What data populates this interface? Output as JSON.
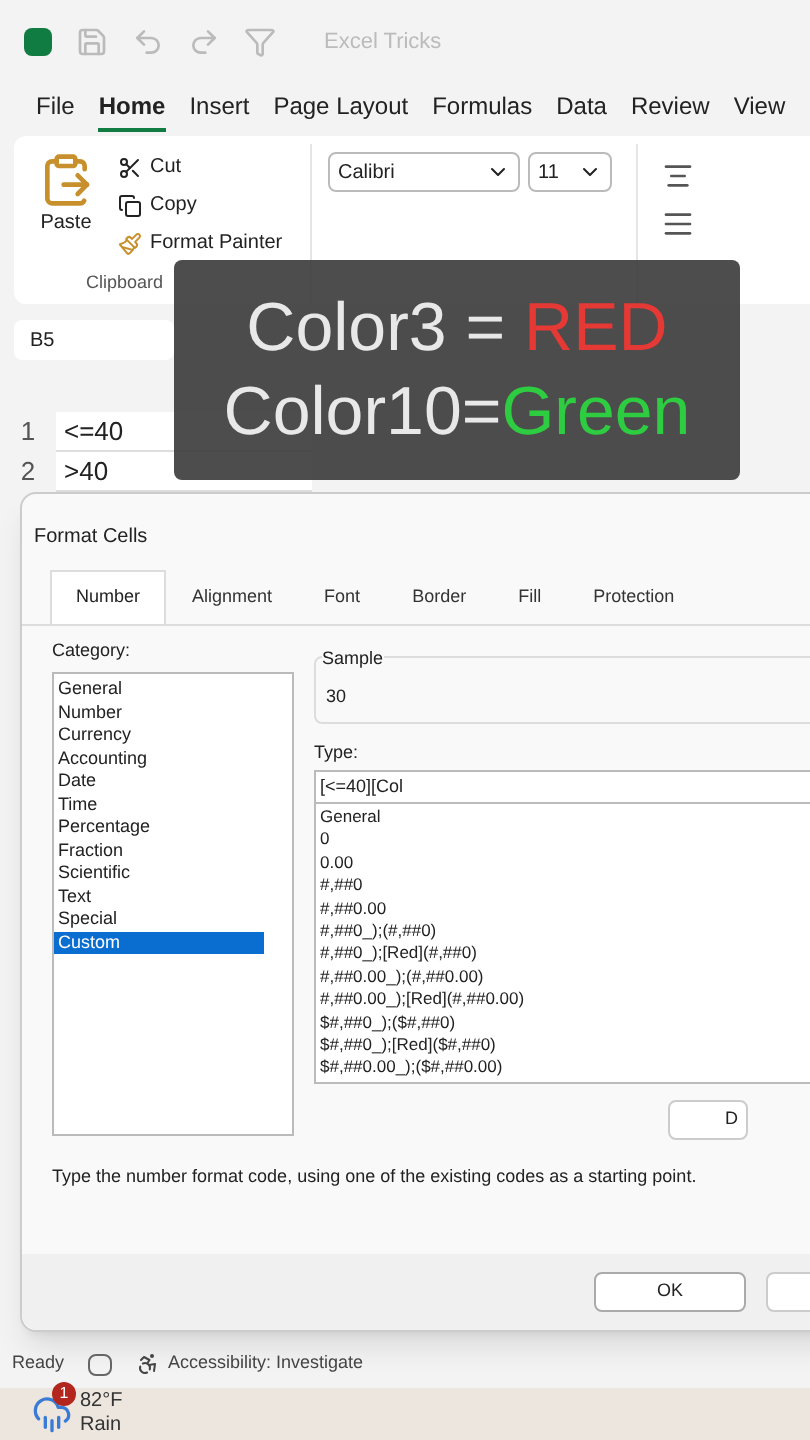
{
  "title_bar": {
    "document": "Excel Tricks"
  },
  "ribbon_tabs": [
    {
      "label": "File",
      "selected": false
    },
    {
      "label": "Home",
      "selected": true
    },
    {
      "label": "Insert",
      "selected": false
    },
    {
      "label": "Page Layout",
      "selected": false
    },
    {
      "label": "Formulas",
      "selected": false
    },
    {
      "label": "Data",
      "selected": false
    },
    {
      "label": "Review",
      "selected": false
    },
    {
      "label": "View",
      "selected": false
    }
  ],
  "clipboard": {
    "paste": "Paste",
    "cut": "Cut",
    "copy": "Copy",
    "format_painter": "Format Painter",
    "group": "Clipboard"
  },
  "font": {
    "name": "Calibri",
    "size": "11"
  },
  "name_box": "B5",
  "sheet": {
    "rows": [
      {
        "header": "1",
        "a": "<=40"
      },
      {
        "header": "2",
        "a": ">40"
      }
    ]
  },
  "caption": {
    "line1": "Color3 = ",
    "line1_accent": "RED",
    "line2": "Color10=",
    "line2_accent": "Green"
  },
  "dialog": {
    "title": "Format Cells",
    "tabs": [
      {
        "label": "Number",
        "selected": true
      },
      {
        "label": "Alignment",
        "selected": false
      },
      {
        "label": "Font",
        "selected": false
      },
      {
        "label": "Border",
        "selected": false
      },
      {
        "label": "Fill",
        "selected": false
      },
      {
        "label": "Protection",
        "selected": false
      }
    ],
    "category_label": "Category:",
    "categories": [
      {
        "label": "General",
        "selected": false
      },
      {
        "label": "Number",
        "selected": false
      },
      {
        "label": "Currency",
        "selected": false
      },
      {
        "label": "Accounting",
        "selected": false
      },
      {
        "label": "Date",
        "selected": false
      },
      {
        "label": "Time",
        "selected": false
      },
      {
        "label": "Percentage",
        "selected": false
      },
      {
        "label": "Fraction",
        "selected": false
      },
      {
        "label": "Scientific",
        "selected": false
      },
      {
        "label": "Text",
        "selected": false
      },
      {
        "label": "Special",
        "selected": false
      },
      {
        "label": "Custom",
        "selected": true
      }
    ],
    "sample_label": "Sample",
    "sample_value": "30",
    "type_label": "Type:",
    "type_value": "[<=40][Col",
    "formats": [
      "General",
      "0",
      "0.00",
      "#,##0",
      "#,##0.00",
      "#,##0_);(#,##0)",
      "#,##0_);[Red](#,##0)",
      "#,##0.00_);(#,##0.00)",
      "#,##0.00_);[Red](#,##0.00)",
      "$#,##0_);($#,##0)",
      "$#,##0_);[Red]($#,##0)",
      "$#,##0.00_);($#,##0.00)"
    ],
    "delete_button": "D",
    "hint": "Type the number format code, using one of the existing codes as a starting point.",
    "ok": "OK"
  },
  "status_bar": {
    "ready": "Ready",
    "accessibility": "Accessibility: Investigate"
  },
  "taskbar": {
    "badge": "1",
    "temperature": "82°F",
    "condition": "Rain"
  }
}
